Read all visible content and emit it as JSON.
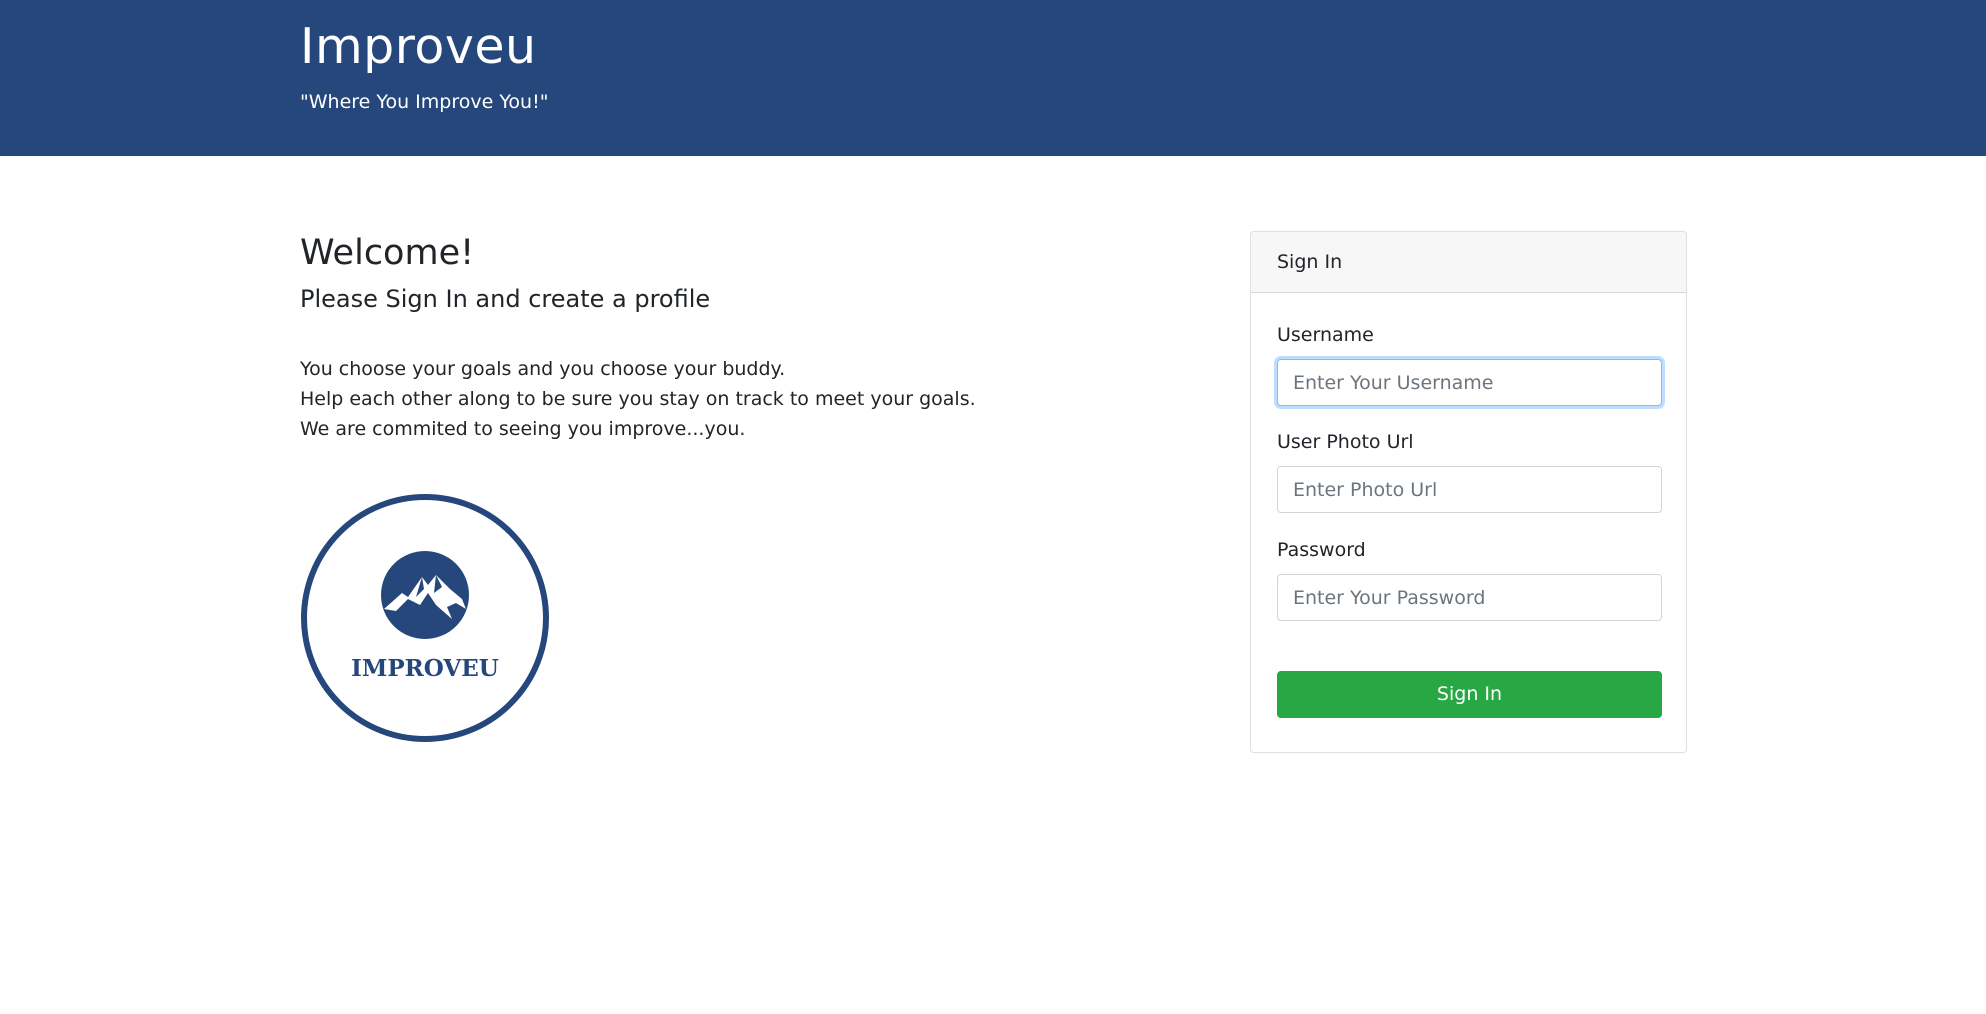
{
  "header": {
    "title": "Improveu",
    "tagline": "\"Where You Improve You!\""
  },
  "intro": {
    "title": "Welcome!",
    "subtitle": "Please Sign In and create a profile",
    "lines": [
      "You choose your goals and you choose your buddy.",
      "Help each other along to be sure you stay on track to meet your goals.",
      "We are commited to seeing you improve...you."
    ]
  },
  "logo": {
    "wordmark": "IMPROVEU",
    "icon": "mountain-icon",
    "color": "#25477b"
  },
  "signin_card": {
    "header": "Sign In",
    "username": {
      "label": "Username",
      "placeholder": "Enter Your Username",
      "value": ""
    },
    "photo_url": {
      "label": "User Photo Url",
      "placeholder": "Enter Photo Url",
      "value": ""
    },
    "password": {
      "label": "Password",
      "placeholder": "Enter Your Password",
      "value": ""
    },
    "submit_label": "Sign In"
  },
  "colors": {
    "brand": "#25477b",
    "button": "#28a745",
    "focus": "#80bdff"
  }
}
